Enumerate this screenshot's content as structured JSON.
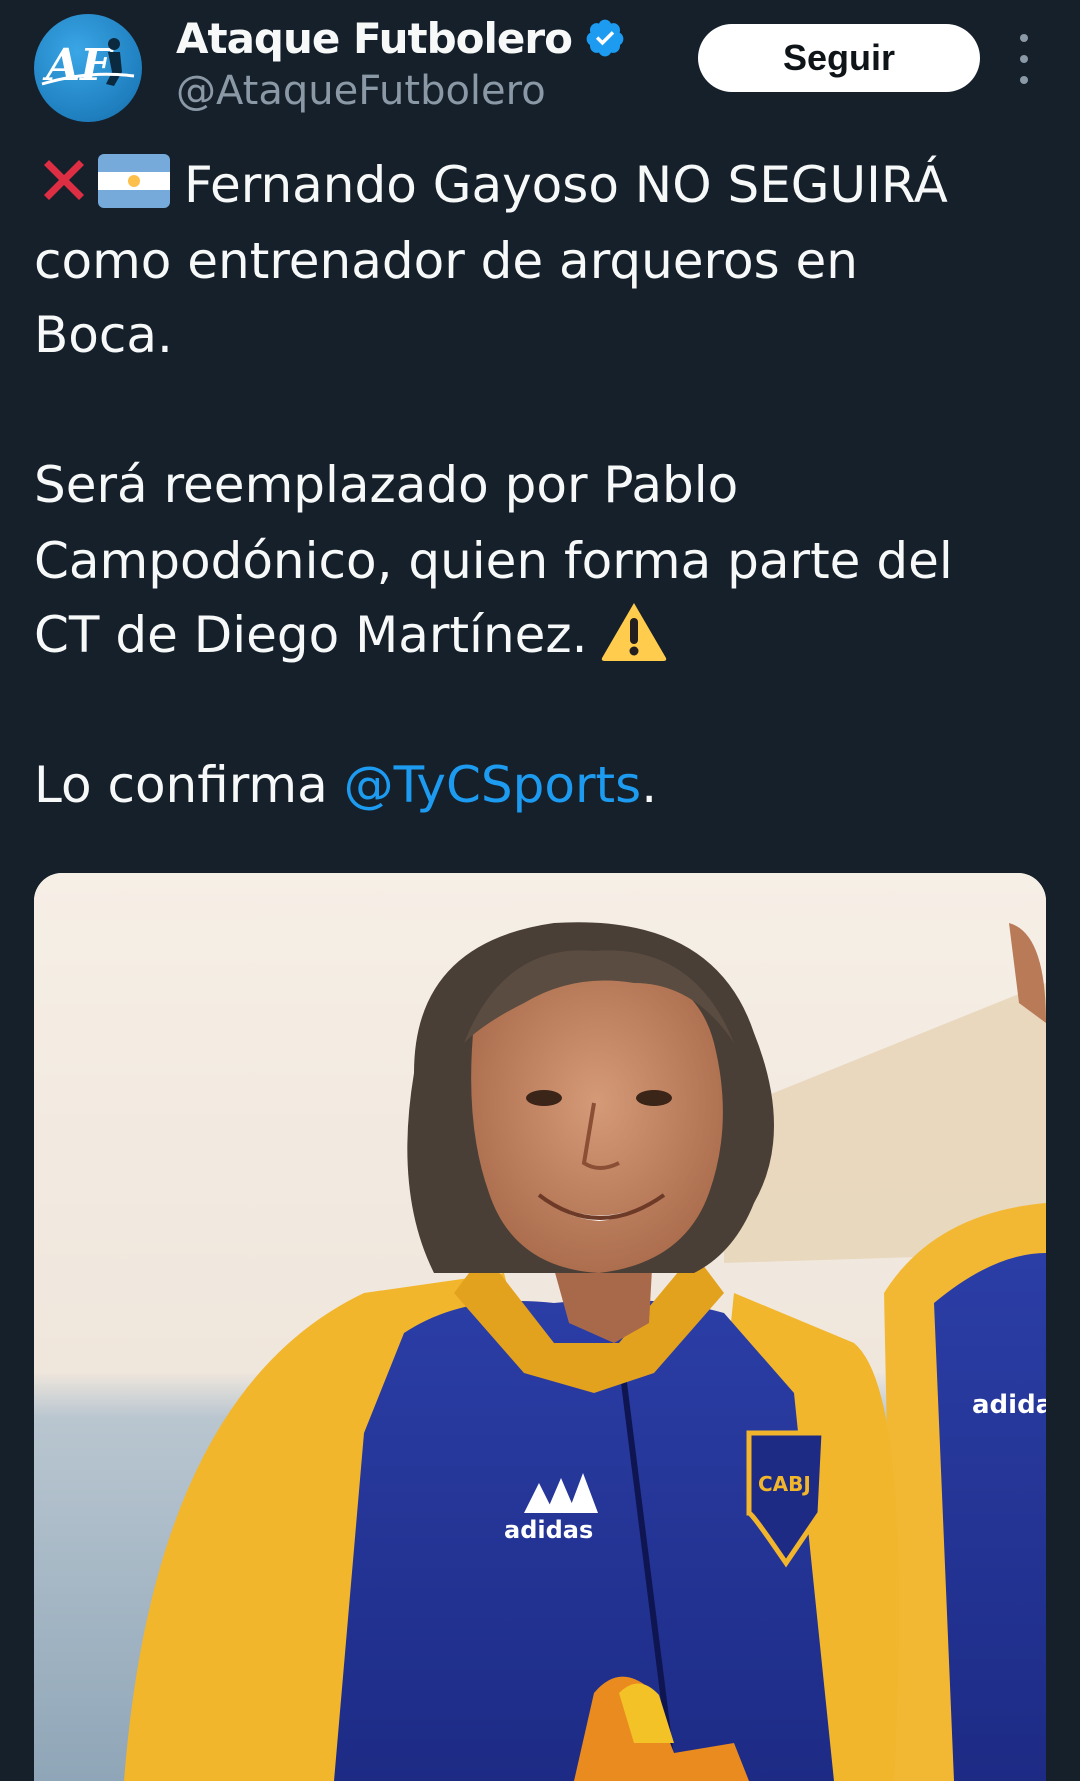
{
  "account": {
    "display_name": "Ataque Futbolero",
    "handle": "@AtaqueFutbolero",
    "avatar_text": "AF",
    "verified": true
  },
  "actions": {
    "follow_label": "Seguir"
  },
  "tweet": {
    "line1_text": "Fernando Gayoso NO SEGUIRÁ",
    "line2_text": "como entrenador de arqueros en",
    "line3_text": "Boca.",
    "line4_text": "Será reemplazado por Pablo",
    "line5_text": "Campodónico, quien forma parte del",
    "line6_text": "CT de Diego Martínez.",
    "line7_prefix": "Lo confirma ",
    "mention": "@TyCSports",
    "line7_suffix": "."
  },
  "media": {
    "crest_text": "CABJ",
    "brand_text": "adidas"
  },
  "icons": {
    "verified": "verified-badge-icon",
    "more": "more-vertical-icon",
    "cross": "cross-mark-emoji",
    "flag": "argentina-flag-emoji",
    "warning": "warning-emoji"
  },
  "colors": {
    "background": "#15202b",
    "text": "#f7f9f9",
    "secondary_text": "#8b98a5",
    "link": "#1d9bf0",
    "follow_button_bg": "#ffffff"
  }
}
